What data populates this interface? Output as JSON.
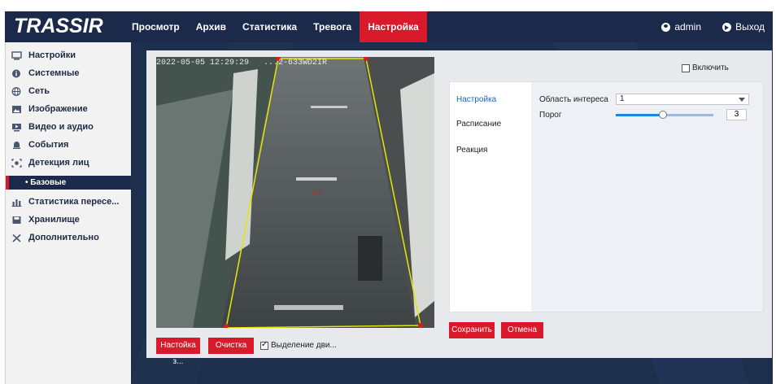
{
  "brand": "TRASSIR",
  "nav": {
    "items": [
      {
        "label": "Просмотр",
        "active": false
      },
      {
        "label": "Архив",
        "active": false
      },
      {
        "label": "Статистика",
        "active": false
      },
      {
        "label": "Тревога",
        "active": false
      },
      {
        "label": "Настройка",
        "active": true
      }
    ],
    "user": "admin",
    "logout": "Выход"
  },
  "sidebar": {
    "items": [
      {
        "label": "Настройки",
        "icon": "settings-icon"
      },
      {
        "label": "Системные",
        "icon": "info-icon"
      },
      {
        "label": "Сеть",
        "icon": "globe-icon"
      },
      {
        "label": "Изображение",
        "icon": "image-icon"
      },
      {
        "label": "Видео и аудио",
        "icon": "video-icon"
      },
      {
        "label": "События",
        "icon": "event-icon"
      },
      {
        "label": "Детекция лиц",
        "icon": "face-icon"
      }
    ],
    "active_sub": "• Базовые",
    "items_after": [
      {
        "label": "Статистика пересе...",
        "icon": "stats-icon"
      },
      {
        "label": "Хранилище",
        "icon": "storage-icon"
      },
      {
        "label": "Дополнительно",
        "icon": "tools-icon"
      }
    ]
  },
  "video": {
    "timestamp": "2022-05-05 12:29:29",
    "camera_name": "...2-633WD2IR",
    "zone_label": "#1",
    "zone_color": "#e6e600"
  },
  "buttons": {
    "zone_settings": "Настойка з...",
    "clear": "Очистка",
    "motion_highlight": "Выделение дви...",
    "motion_highlight_checked": true,
    "save": "Сохранить",
    "cancel": "Отмена"
  },
  "enable": {
    "label": "Включить",
    "checked": false
  },
  "settings": {
    "tabs": [
      "Настройка",
      "Расписание",
      "Реакция"
    ],
    "active_tab": "Настройка",
    "roi_label": "Область интереса",
    "roi_value": "1",
    "threshold_label": "Порог",
    "threshold_value": "3",
    "threshold_fraction": 0.48
  },
  "colors": {
    "accent": "#d91a2a",
    "navy": "#1b2a4a",
    "link": "#1c64b8"
  }
}
